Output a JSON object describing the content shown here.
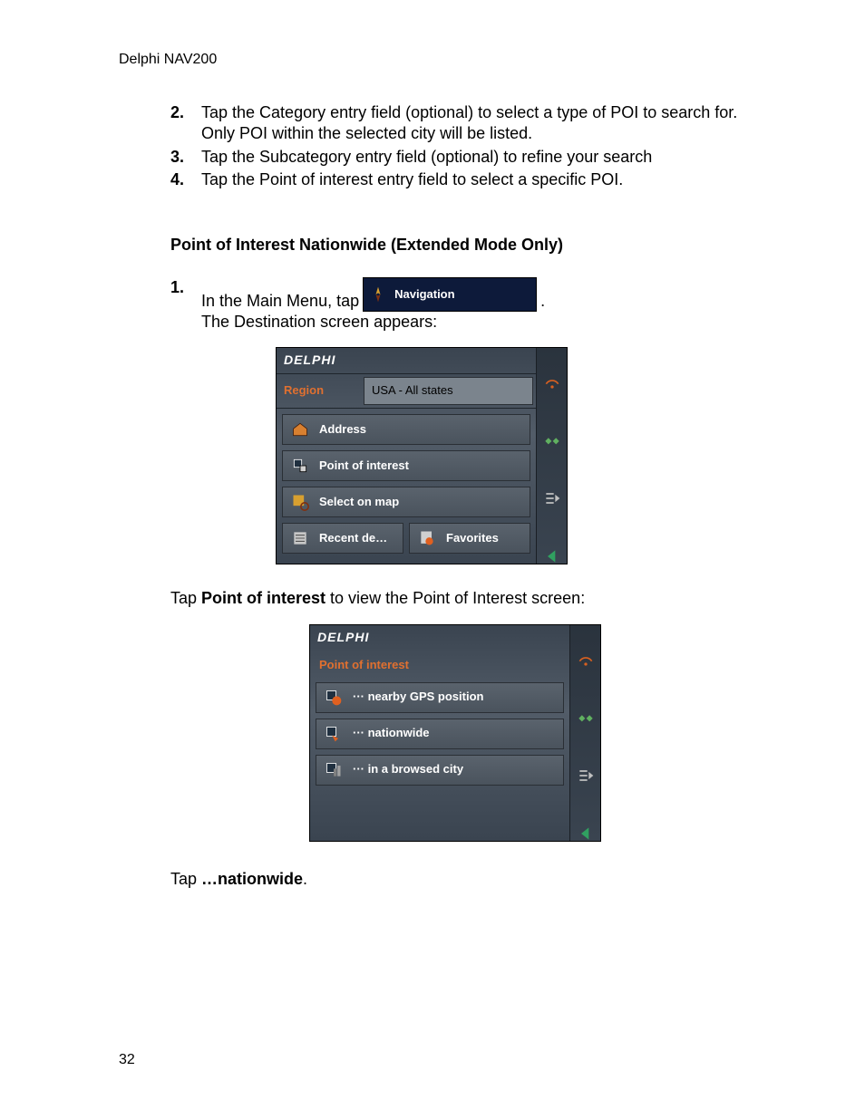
{
  "header": {
    "product": "Delphi NAV200"
  },
  "steps_top": [
    {
      "n": "2.",
      "text": "Tap the Category entry field (optional) to select a type of POI to search for. Only POI within the selected city will be listed."
    },
    {
      "n": "3.",
      "text": "Tap the Subcategory entry field (optional) to refine your search"
    },
    {
      "n": "4.",
      "text": "Tap the Point of interest entry field to select a specific POI."
    }
  ],
  "section_title": "Point of Interest Nationwide (Extended Mode Only)",
  "step1": {
    "n": "1.",
    "pre": "In the Main Menu, tap",
    "button_label": "Navigation",
    "post": " The Destination screen appears:"
  },
  "device1": {
    "brand": "DELPHI",
    "region_label": "Region",
    "region_value": "USA - All states",
    "rows": [
      {
        "icon": "house-icon",
        "label": "Address"
      },
      {
        "icon": "poi-icon",
        "label": "Point of interest"
      },
      {
        "icon": "map-pick-icon",
        "label": "Select on map"
      }
    ],
    "split": [
      {
        "icon": "recent-icon",
        "label": "Recent de…"
      },
      {
        "icon": "favorites-icon",
        "label": "Favorites"
      }
    ]
  },
  "mid_text_pre": "Tap ",
  "mid_text_bold": "Point of interest",
  "mid_text_post": " to view the Point of Interest screen:",
  "device2": {
    "brand": "DELPHI",
    "title": "Point of interest",
    "rows": [
      {
        "icon": "gps-icon",
        "label": "··· nearby GPS position"
      },
      {
        "icon": "nation-icon",
        "label": "··· nationwide"
      },
      {
        "icon": "city-icon",
        "label": "··· in a browsed city"
      }
    ]
  },
  "after_text_pre": "Tap ",
  "after_text_bold": "…nationwide",
  "after_text_post": ".",
  "page_number": "32"
}
